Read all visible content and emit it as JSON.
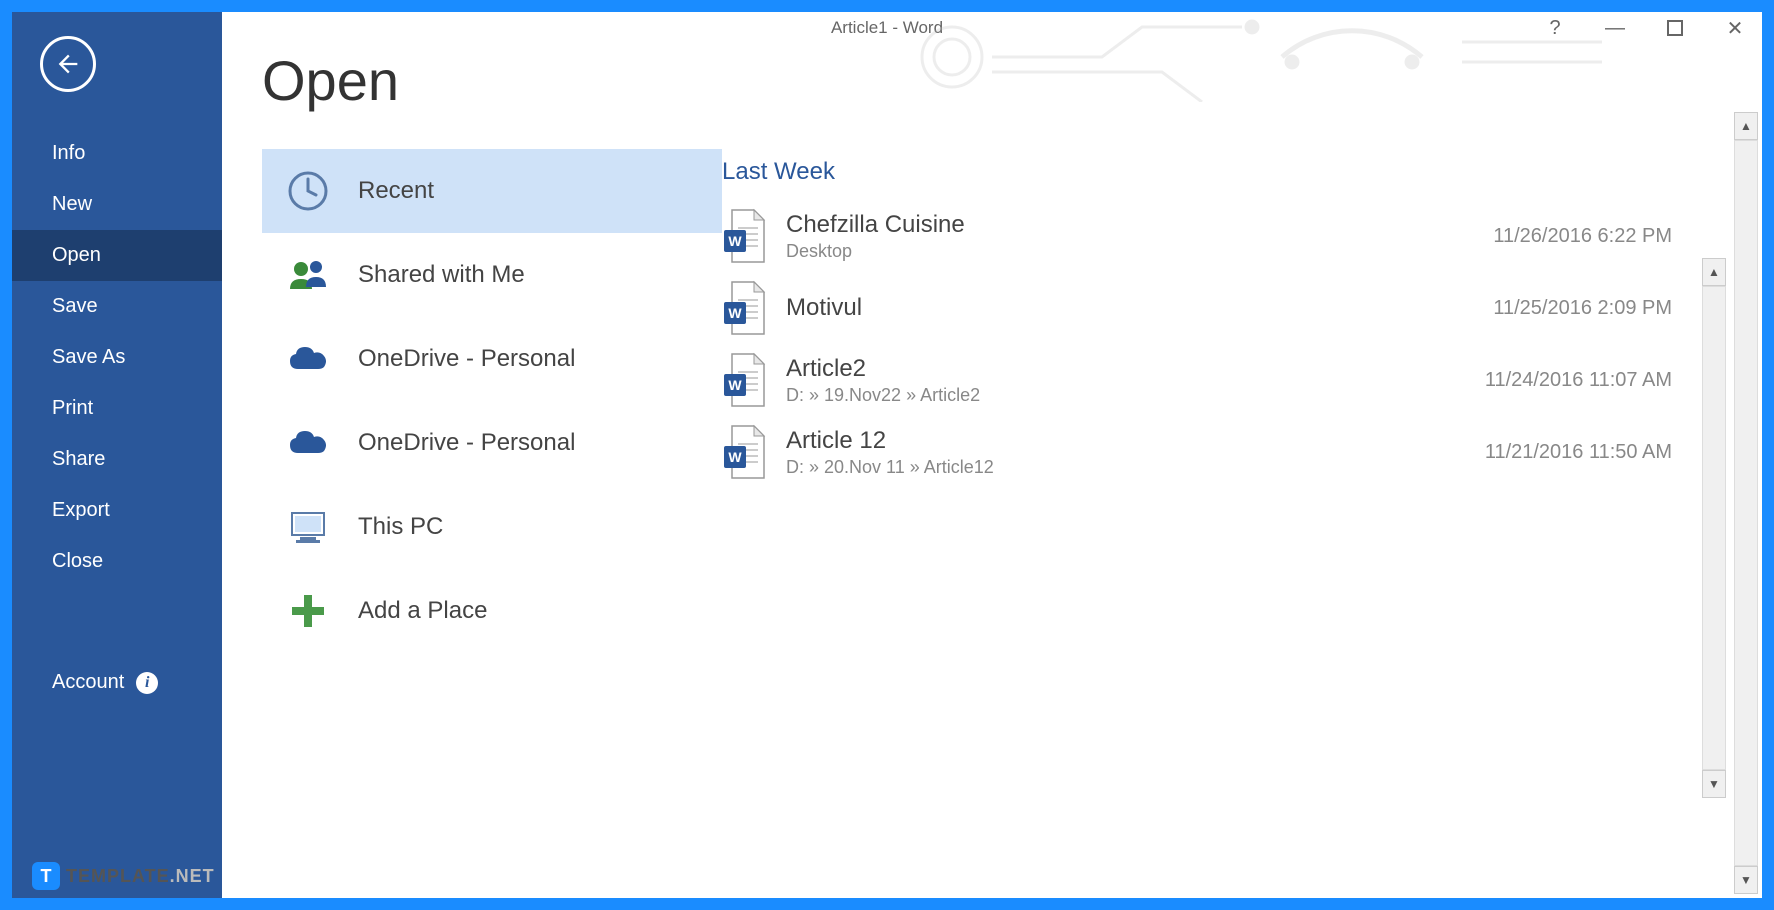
{
  "titlebar": {
    "title": "Article1  -  Word"
  },
  "sidebar": {
    "nav": [
      "Info",
      "New",
      "Open",
      "Save",
      "Save As",
      "Print",
      "Share",
      "Export",
      "Close"
    ],
    "active": "Open",
    "account": "Account"
  },
  "page": {
    "title": "Open"
  },
  "places": [
    {
      "icon": "clock-icon",
      "label": "Recent",
      "selected": true
    },
    {
      "icon": "people-icon",
      "label": "Shared with Me",
      "selected": false
    },
    {
      "icon": "cloud-icon",
      "label": "OneDrive - Personal",
      "selected": false
    },
    {
      "icon": "cloud-icon",
      "label": "OneDrive - Personal",
      "selected": false
    },
    {
      "icon": "computer-icon",
      "label": "This PC",
      "selected": false
    },
    {
      "icon": "plus-icon",
      "label": "Add a Place",
      "selected": false
    }
  ],
  "files_section": "Last Week",
  "files": [
    {
      "name": "Chefzilla Cuisine",
      "path": "Desktop",
      "date": "11/26/2016 6:22 PM"
    },
    {
      "name": "Motivul",
      "path": "",
      "date": "11/25/2016 2:09 PM"
    },
    {
      "name": "Article2",
      "path": "D: » 19.Nov22 » Article2",
      "date": "11/24/2016 11:07 AM"
    },
    {
      "name": "Article 12",
      "path": "D: » 20.Nov 11 » Article12",
      "date": "11/21/2016 11:50 AM"
    }
  ],
  "watermark": {
    "badge": "T",
    "text": "TEMPLATE",
    "net": ".NET"
  }
}
